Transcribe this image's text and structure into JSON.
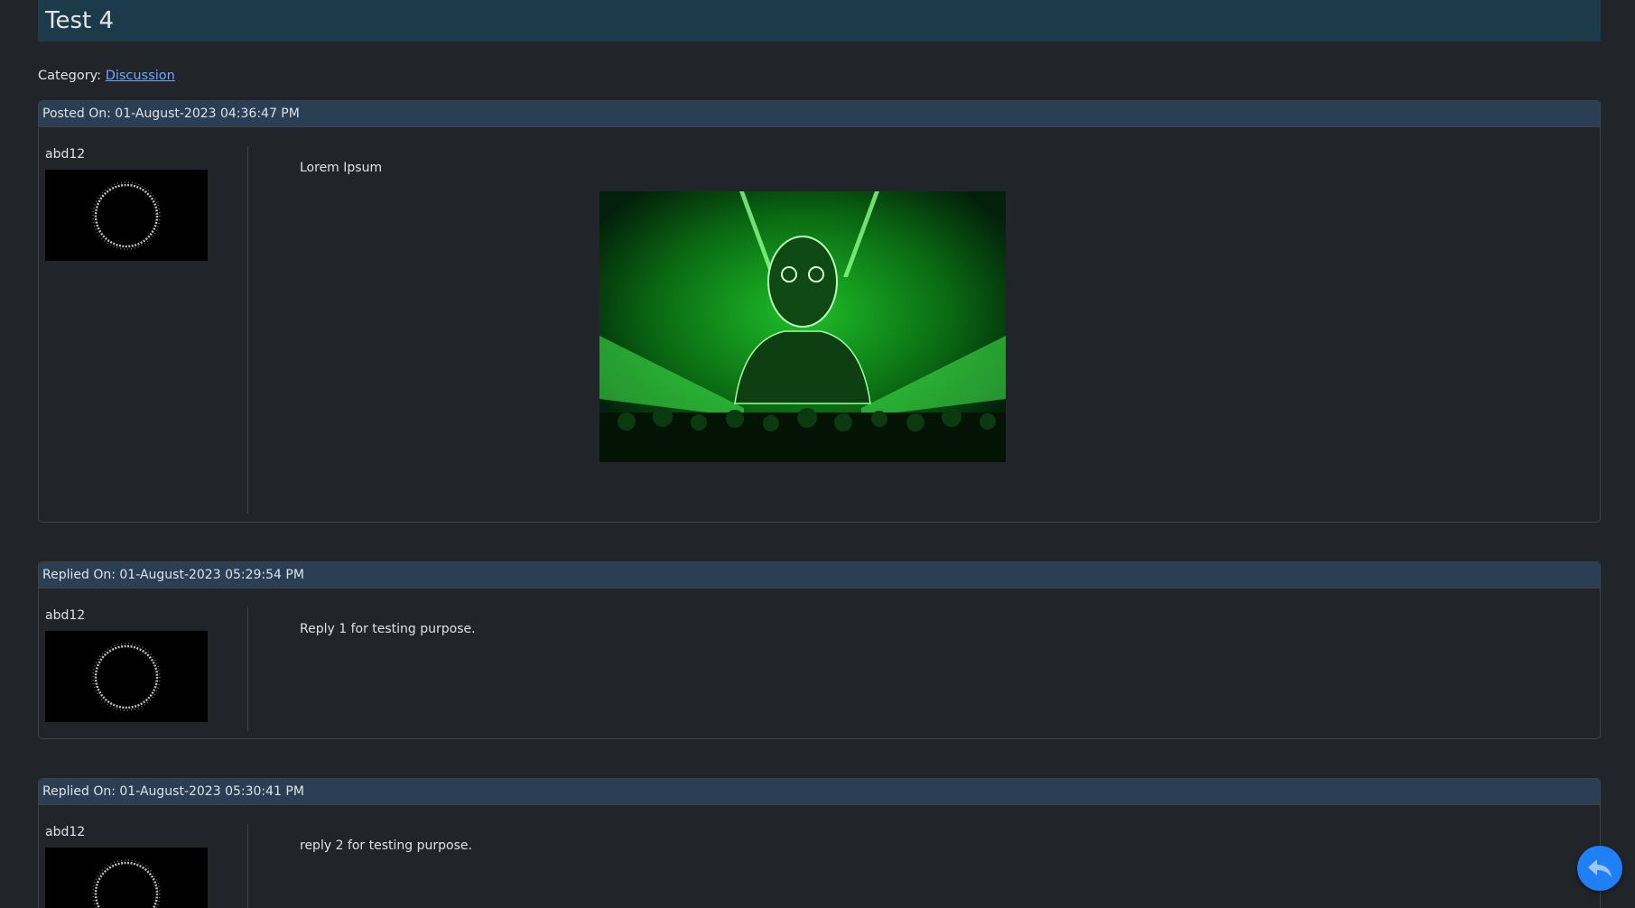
{
  "thread": {
    "title": "Test 4"
  },
  "category": {
    "label": "Category:",
    "link": "Discussion"
  },
  "posts": [
    {
      "header": "Posted On: 01-August-2023 04:36:47 PM",
      "username": "abd12",
      "message": "Lorem Ipsum"
    },
    {
      "header": "Replied On: 01-August-2023 05:29:54 PM",
      "username": "abd12",
      "message": "Reply 1 for testing purpose."
    },
    {
      "header": "Replied On: 01-August-2023 05:30:41 PM",
      "username": "abd12",
      "message": "reply 2 for testing purpose."
    }
  ],
  "icons": {
    "reply": "reply-arrow-icon",
    "avatar": "ring-avatar-image"
  },
  "colors": {
    "background": "#212529",
    "title_bar": "#1c3b4a",
    "card_header": "#2b3f54",
    "link": "#6ea8fe",
    "fab": "#1f7ff5"
  }
}
